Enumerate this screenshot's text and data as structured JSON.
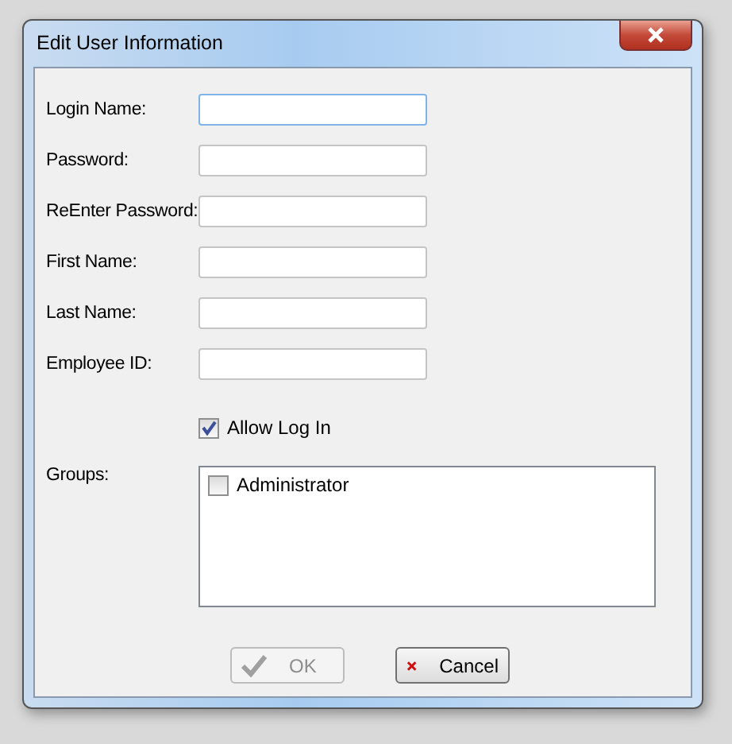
{
  "window": {
    "title": "Edit User Information"
  },
  "fields": [
    {
      "label": "Login Name:",
      "focused": true
    },
    {
      "label": "Password:",
      "focused": false
    },
    {
      "label": "ReEnter Password:",
      "focused": false
    },
    {
      "label": "First Name:",
      "focused": false
    },
    {
      "label": "Last Name:",
      "focused": false
    },
    {
      "label": "Employee ID:",
      "focused": false
    }
  ],
  "allow_login": {
    "label": "Allow Log In",
    "checked": true
  },
  "groups": {
    "label": "Groups:",
    "items": [
      {
        "label": "Administrator",
        "checked": false
      }
    ]
  },
  "buttons": [
    {
      "kind": "ok",
      "label": "OK",
      "disabled": true
    },
    {
      "kind": "cancel",
      "label": "Cancel",
      "disabled": false
    }
  ]
}
